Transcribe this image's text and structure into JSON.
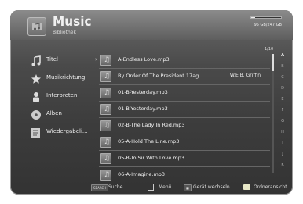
{
  "header": {
    "title": "Music",
    "subtitle": "Bibliothek",
    "storage_text": "95 GB/247 GB",
    "storage_fraction": 0.14
  },
  "sidebar": {
    "items": [
      {
        "label": "Titel",
        "icon": "music-note-icon",
        "arrow": "›"
      },
      {
        "label": "Musikrichtung",
        "icon": "star-icon"
      },
      {
        "label": "Interpreten",
        "icon": "person-icon"
      },
      {
        "label": "Alben",
        "icon": "disc-icon"
      },
      {
        "label": "Wiedergabeli...",
        "icon": "playlist-icon"
      }
    ]
  },
  "list": {
    "page_indicator": "1/10",
    "rows": [
      {
        "title": "A-Endless Love.mp3",
        "artist": ""
      },
      {
        "title": "By Order Of The President 17ag",
        "artist": "W.E.B. Griffin"
      },
      {
        "title": "01-B-Yesterday.mp3",
        "artist": ""
      },
      {
        "title": "01-B-Yesterday.mp3",
        "artist": ""
      },
      {
        "title": "02-B-The Lady In Red.mp3",
        "artist": ""
      },
      {
        "title": "05-A-Hold The Line.mp3",
        "artist": ""
      },
      {
        "title": "05-B-To Sir With Love.mp3",
        "artist": ""
      },
      {
        "title": "06-A-Imagine.mp3",
        "artist": ""
      }
    ]
  },
  "alphabet": [
    "A",
    "B",
    "C",
    "D",
    "E",
    "F",
    "G",
    "H",
    "I",
    "J",
    "K"
  ],
  "footer": {
    "search_key": "SEARCH",
    "search_label": "Suche",
    "menu_label": "Menü",
    "device_key": "■",
    "device_label": "Gerät wechseln",
    "folder_label": "Ordneransicht"
  },
  "colors": {
    "panel": "#3d3d3d",
    "header": "#6e6e6e",
    "text": "#f2f2f2"
  }
}
